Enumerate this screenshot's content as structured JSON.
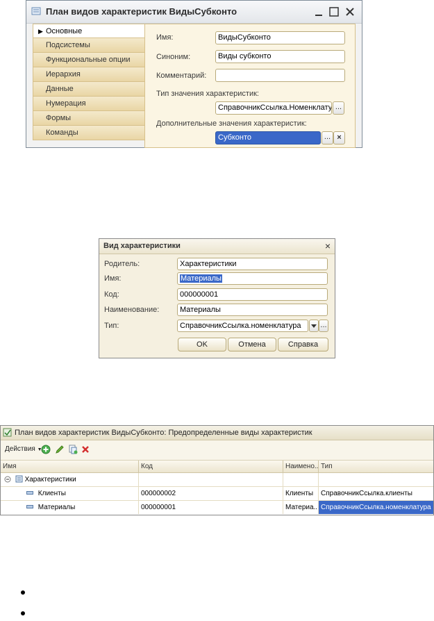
{
  "window1": {
    "title": "План видов характеристик ВидыСубконто",
    "nav": [
      "Основные",
      "Подсистемы",
      "Функциональные опции",
      "Иерархия",
      "Данные",
      "Нумерация",
      "Формы",
      "Команды"
    ],
    "labels": {
      "name": "Имя:",
      "synonym": "Синоним:",
      "comment": "Комментарий:",
      "value_type": "Тип значения характеристик:",
      "extra_values": "Дополнительные значения характеристик:"
    },
    "values": {
      "name": "ВидыСубконто",
      "synonym": "Виды субконто",
      "comment": "",
      "value_type": "СправочникСсылка.Номенклату",
      "extra_values": "Субконто"
    },
    "ellipsis": "...",
    "clear": "×"
  },
  "window2": {
    "title": "Вид характеристики",
    "close": "×",
    "labels": {
      "parent": "Родитель:",
      "name": "Имя:",
      "code": "Код:",
      "description": "Наименование:",
      "type": "Тип:"
    },
    "values": {
      "parent": "Характеристики",
      "name": "Материалы",
      "code": "000000001",
      "description": "Материалы",
      "type": "СправочникСсылка.номенклатура"
    },
    "ellipsis": "...",
    "buttons": {
      "ok": "OK",
      "cancel": "Отмена",
      "help": "Справка"
    }
  },
  "window3": {
    "title": "План видов характеристик ВидыСубконто: Предопределенные виды характеристик",
    "toolbar": {
      "actions": "Действия"
    },
    "columns": [
      "Имя",
      "Код",
      "Наимено...",
      "Тип"
    ],
    "group": "Характеристики",
    "rows": [
      {
        "name": "Клиенты",
        "code": "000000002",
        "desc": "Клиенты",
        "type": "СправочникСсылка.клиенты"
      },
      {
        "name": "Материалы",
        "code": "000000001",
        "desc": "Материа...",
        "type": "СправочникСсылка.номенклатура"
      }
    ]
  }
}
